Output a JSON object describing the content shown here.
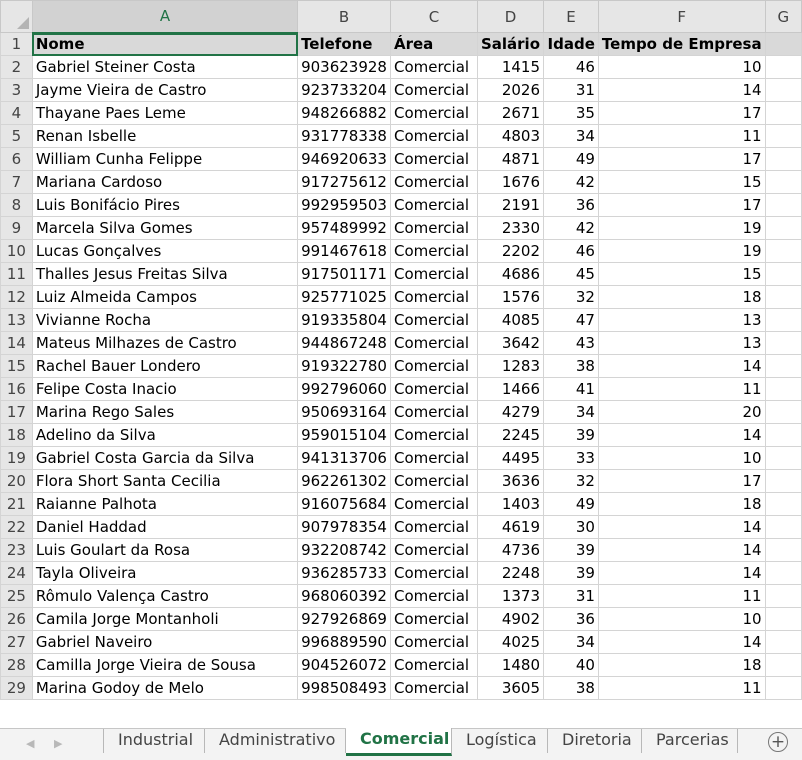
{
  "columns": [
    "A",
    "B",
    "C",
    "D",
    "E",
    "F",
    "G"
  ],
  "header": {
    "nome": "Nome",
    "telefone": "Telefone",
    "area": "Área",
    "salario": "Salário",
    "idade": "Idade",
    "tempo": "Tempo de Empresa"
  },
  "rows": [
    {
      "n": "2",
      "nome": "Gabriel Steiner Costa",
      "tel": "903623928",
      "area": "Comercial",
      "sal": "1415",
      "idade": "46",
      "tempo": "10"
    },
    {
      "n": "3",
      "nome": "Jayme Vieira de Castro",
      "tel": "923733204",
      "area": "Comercial",
      "sal": "2026",
      "idade": "31",
      "tempo": "14"
    },
    {
      "n": "4",
      "nome": "Thayane Paes Leme",
      "tel": "948266882",
      "area": "Comercial",
      "sal": "2671",
      "idade": "35",
      "tempo": "17"
    },
    {
      "n": "5",
      "nome": "Renan Isbelle",
      "tel": "931778338",
      "area": "Comercial",
      "sal": "4803",
      "idade": "34",
      "tempo": "11"
    },
    {
      "n": "6",
      "nome": "William Cunha Felippe",
      "tel": "946920633",
      "area": "Comercial",
      "sal": "4871",
      "idade": "49",
      "tempo": "17"
    },
    {
      "n": "7",
      "nome": "Mariana Cardoso",
      "tel": "917275612",
      "area": "Comercial",
      "sal": "1676",
      "idade": "42",
      "tempo": "15"
    },
    {
      "n": "8",
      "nome": "Luis Bonifácio Pires",
      "tel": "992959503",
      "area": "Comercial",
      "sal": "2191",
      "idade": "36",
      "tempo": "17"
    },
    {
      "n": "9",
      "nome": "Marcela Silva Gomes",
      "tel": "957489992",
      "area": "Comercial",
      "sal": "2330",
      "idade": "42",
      "tempo": "19"
    },
    {
      "n": "10",
      "nome": "Lucas Gonçalves",
      "tel": "991467618",
      "area": "Comercial",
      "sal": "2202",
      "idade": "46",
      "tempo": "19"
    },
    {
      "n": "11",
      "nome": "Thalles Jesus Freitas Silva",
      "tel": "917501171",
      "area": "Comercial",
      "sal": "4686",
      "idade": "45",
      "tempo": "15"
    },
    {
      "n": "12",
      "nome": "Luiz Almeida Campos",
      "tel": "925771025",
      "area": "Comercial",
      "sal": "1576",
      "idade": "32",
      "tempo": "18"
    },
    {
      "n": "13",
      "nome": "Vivianne Rocha",
      "tel": "919335804",
      "area": "Comercial",
      "sal": "4085",
      "idade": "47",
      "tempo": "13"
    },
    {
      "n": "14",
      "nome": "Mateus Milhazes de Castro",
      "tel": "944867248",
      "area": "Comercial",
      "sal": "3642",
      "idade": "43",
      "tempo": "13"
    },
    {
      "n": "15",
      "nome": "Rachel Bauer Londero",
      "tel": "919322780",
      "area": "Comercial",
      "sal": "1283",
      "idade": "38",
      "tempo": "14"
    },
    {
      "n": "16",
      "nome": "Felipe Costa Inacio",
      "tel": "992796060",
      "area": "Comercial",
      "sal": "1466",
      "idade": "41",
      "tempo": "11"
    },
    {
      "n": "17",
      "nome": "Marina Rego Sales",
      "tel": "950693164",
      "area": "Comercial",
      "sal": "4279",
      "idade": "34",
      "tempo": "20"
    },
    {
      "n": "18",
      "nome": "Adelino da Silva",
      "tel": "959015104",
      "area": "Comercial",
      "sal": "2245",
      "idade": "39",
      "tempo": "14"
    },
    {
      "n": "19",
      "nome": "Gabriel Costa Garcia da Silva",
      "tel": "941313706",
      "area": "Comercial",
      "sal": "4495",
      "idade": "33",
      "tempo": "10"
    },
    {
      "n": "20",
      "nome": "Flora Short Santa Cecilia",
      "tel": "962261302",
      "area": "Comercial",
      "sal": "3636",
      "idade": "32",
      "tempo": "17"
    },
    {
      "n": "21",
      "nome": "Raianne Palhota",
      "tel": "916075684",
      "area": "Comercial",
      "sal": "1403",
      "idade": "49",
      "tempo": "18"
    },
    {
      "n": "22",
      "nome": "Daniel Haddad",
      "tel": "907978354",
      "area": "Comercial",
      "sal": "4619",
      "idade": "30",
      "tempo": "14"
    },
    {
      "n": "23",
      "nome": "Luis Goulart da Rosa",
      "tel": "932208742",
      "area": "Comercial",
      "sal": "4736",
      "idade": "39",
      "tempo": "14"
    },
    {
      "n": "24",
      "nome": "Tayla Oliveira",
      "tel": "936285733",
      "area": "Comercial",
      "sal": "2248",
      "idade": "39",
      "tempo": "14"
    },
    {
      "n": "25",
      "nome": "Rômulo Valença Castro",
      "tel": "968060392",
      "area": "Comercial",
      "sal": "1373",
      "idade": "31",
      "tempo": "11"
    },
    {
      "n": "26",
      "nome": "Camila Jorge Montanholi",
      "tel": "927926869",
      "area": "Comercial",
      "sal": "4902",
      "idade": "36",
      "tempo": "10"
    },
    {
      "n": "27",
      "nome": "Gabriel Naveiro",
      "tel": "996889590",
      "area": "Comercial",
      "sal": "4025",
      "idade": "34",
      "tempo": "14"
    },
    {
      "n": "28",
      "nome": "Camilla Jorge Vieira de Sousa",
      "tel": "904526072",
      "area": "Comercial",
      "sal": "1480",
      "idade": "40",
      "tempo": "18"
    },
    {
      "n": "29",
      "nome": "Marina Godoy de Melo",
      "tel": "998508493",
      "area": "Comercial",
      "sal": "3605",
      "idade": "38",
      "tempo": "11"
    }
  ],
  "tabs": [
    {
      "label": "Industrial",
      "active": false
    },
    {
      "label": "Administrativo",
      "active": false
    },
    {
      "label": "Comercial",
      "active": true
    },
    {
      "label": "Logística",
      "active": false
    },
    {
      "label": "Diretoria",
      "active": false
    },
    {
      "label": "Parcerias",
      "active": false
    }
  ],
  "nav": {
    "prev": "◀",
    "next": "▶"
  },
  "add_sheet_label": "+"
}
